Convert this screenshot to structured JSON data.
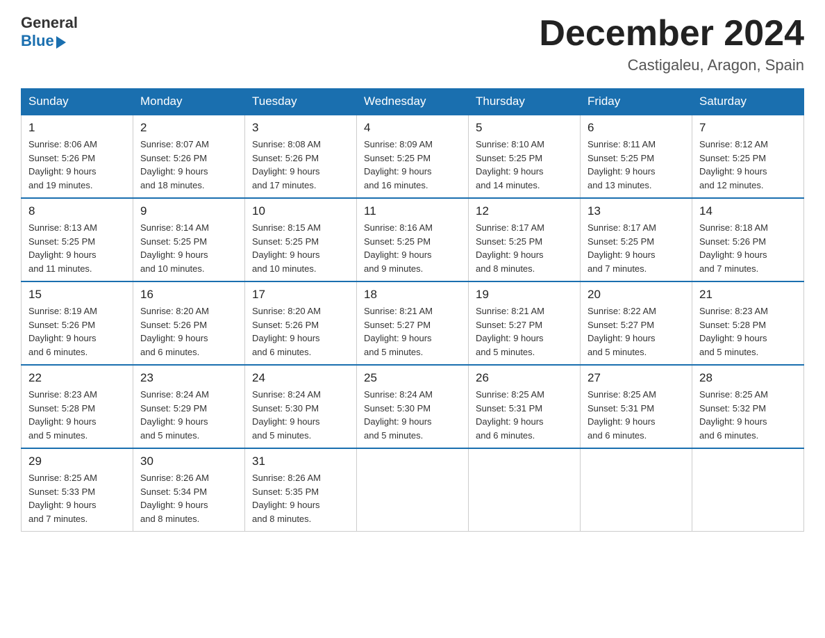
{
  "logo": {
    "general": "General",
    "blue": "Blue"
  },
  "title": "December 2024",
  "location": "Castigaleu, Aragon, Spain",
  "days_of_week": [
    "Sunday",
    "Monday",
    "Tuesday",
    "Wednesday",
    "Thursday",
    "Friday",
    "Saturday"
  ],
  "weeks": [
    [
      {
        "day": "1",
        "sunrise": "8:06 AM",
        "sunset": "5:26 PM",
        "daylight": "9 hours and 19 minutes."
      },
      {
        "day": "2",
        "sunrise": "8:07 AM",
        "sunset": "5:26 PM",
        "daylight": "9 hours and 18 minutes."
      },
      {
        "day": "3",
        "sunrise": "8:08 AM",
        "sunset": "5:26 PM",
        "daylight": "9 hours and 17 minutes."
      },
      {
        "day": "4",
        "sunrise": "8:09 AM",
        "sunset": "5:25 PM",
        "daylight": "9 hours and 16 minutes."
      },
      {
        "day": "5",
        "sunrise": "8:10 AM",
        "sunset": "5:25 PM",
        "daylight": "9 hours and 14 minutes."
      },
      {
        "day": "6",
        "sunrise": "8:11 AM",
        "sunset": "5:25 PM",
        "daylight": "9 hours and 13 minutes."
      },
      {
        "day": "7",
        "sunrise": "8:12 AM",
        "sunset": "5:25 PM",
        "daylight": "9 hours and 12 minutes."
      }
    ],
    [
      {
        "day": "8",
        "sunrise": "8:13 AM",
        "sunset": "5:25 PM",
        "daylight": "9 hours and 11 minutes."
      },
      {
        "day": "9",
        "sunrise": "8:14 AM",
        "sunset": "5:25 PM",
        "daylight": "9 hours and 10 minutes."
      },
      {
        "day": "10",
        "sunrise": "8:15 AM",
        "sunset": "5:25 PM",
        "daylight": "9 hours and 10 minutes."
      },
      {
        "day": "11",
        "sunrise": "8:16 AM",
        "sunset": "5:25 PM",
        "daylight": "9 hours and 9 minutes."
      },
      {
        "day": "12",
        "sunrise": "8:17 AM",
        "sunset": "5:25 PM",
        "daylight": "9 hours and 8 minutes."
      },
      {
        "day": "13",
        "sunrise": "8:17 AM",
        "sunset": "5:25 PM",
        "daylight": "9 hours and 7 minutes."
      },
      {
        "day": "14",
        "sunrise": "8:18 AM",
        "sunset": "5:26 PM",
        "daylight": "9 hours and 7 minutes."
      }
    ],
    [
      {
        "day": "15",
        "sunrise": "8:19 AM",
        "sunset": "5:26 PM",
        "daylight": "9 hours and 6 minutes."
      },
      {
        "day": "16",
        "sunrise": "8:20 AM",
        "sunset": "5:26 PM",
        "daylight": "9 hours and 6 minutes."
      },
      {
        "day": "17",
        "sunrise": "8:20 AM",
        "sunset": "5:26 PM",
        "daylight": "9 hours and 6 minutes."
      },
      {
        "day": "18",
        "sunrise": "8:21 AM",
        "sunset": "5:27 PM",
        "daylight": "9 hours and 5 minutes."
      },
      {
        "day": "19",
        "sunrise": "8:21 AM",
        "sunset": "5:27 PM",
        "daylight": "9 hours and 5 minutes."
      },
      {
        "day": "20",
        "sunrise": "8:22 AM",
        "sunset": "5:27 PM",
        "daylight": "9 hours and 5 minutes."
      },
      {
        "day": "21",
        "sunrise": "8:23 AM",
        "sunset": "5:28 PM",
        "daylight": "9 hours and 5 minutes."
      }
    ],
    [
      {
        "day": "22",
        "sunrise": "8:23 AM",
        "sunset": "5:28 PM",
        "daylight": "9 hours and 5 minutes."
      },
      {
        "day": "23",
        "sunrise": "8:24 AM",
        "sunset": "5:29 PM",
        "daylight": "9 hours and 5 minutes."
      },
      {
        "day": "24",
        "sunrise": "8:24 AM",
        "sunset": "5:30 PM",
        "daylight": "9 hours and 5 minutes."
      },
      {
        "day": "25",
        "sunrise": "8:24 AM",
        "sunset": "5:30 PM",
        "daylight": "9 hours and 5 minutes."
      },
      {
        "day": "26",
        "sunrise": "8:25 AM",
        "sunset": "5:31 PM",
        "daylight": "9 hours and 6 minutes."
      },
      {
        "day": "27",
        "sunrise": "8:25 AM",
        "sunset": "5:31 PM",
        "daylight": "9 hours and 6 minutes."
      },
      {
        "day": "28",
        "sunrise": "8:25 AM",
        "sunset": "5:32 PM",
        "daylight": "9 hours and 6 minutes."
      }
    ],
    [
      {
        "day": "29",
        "sunrise": "8:25 AM",
        "sunset": "5:33 PM",
        "daylight": "9 hours and 7 minutes."
      },
      {
        "day": "30",
        "sunrise": "8:26 AM",
        "sunset": "5:34 PM",
        "daylight": "9 hours and 8 minutes."
      },
      {
        "day": "31",
        "sunrise": "8:26 AM",
        "sunset": "5:35 PM",
        "daylight": "9 hours and 8 minutes."
      },
      null,
      null,
      null,
      null
    ]
  ],
  "labels": {
    "sunrise": "Sunrise:",
    "sunset": "Sunset:",
    "daylight": "Daylight:"
  }
}
